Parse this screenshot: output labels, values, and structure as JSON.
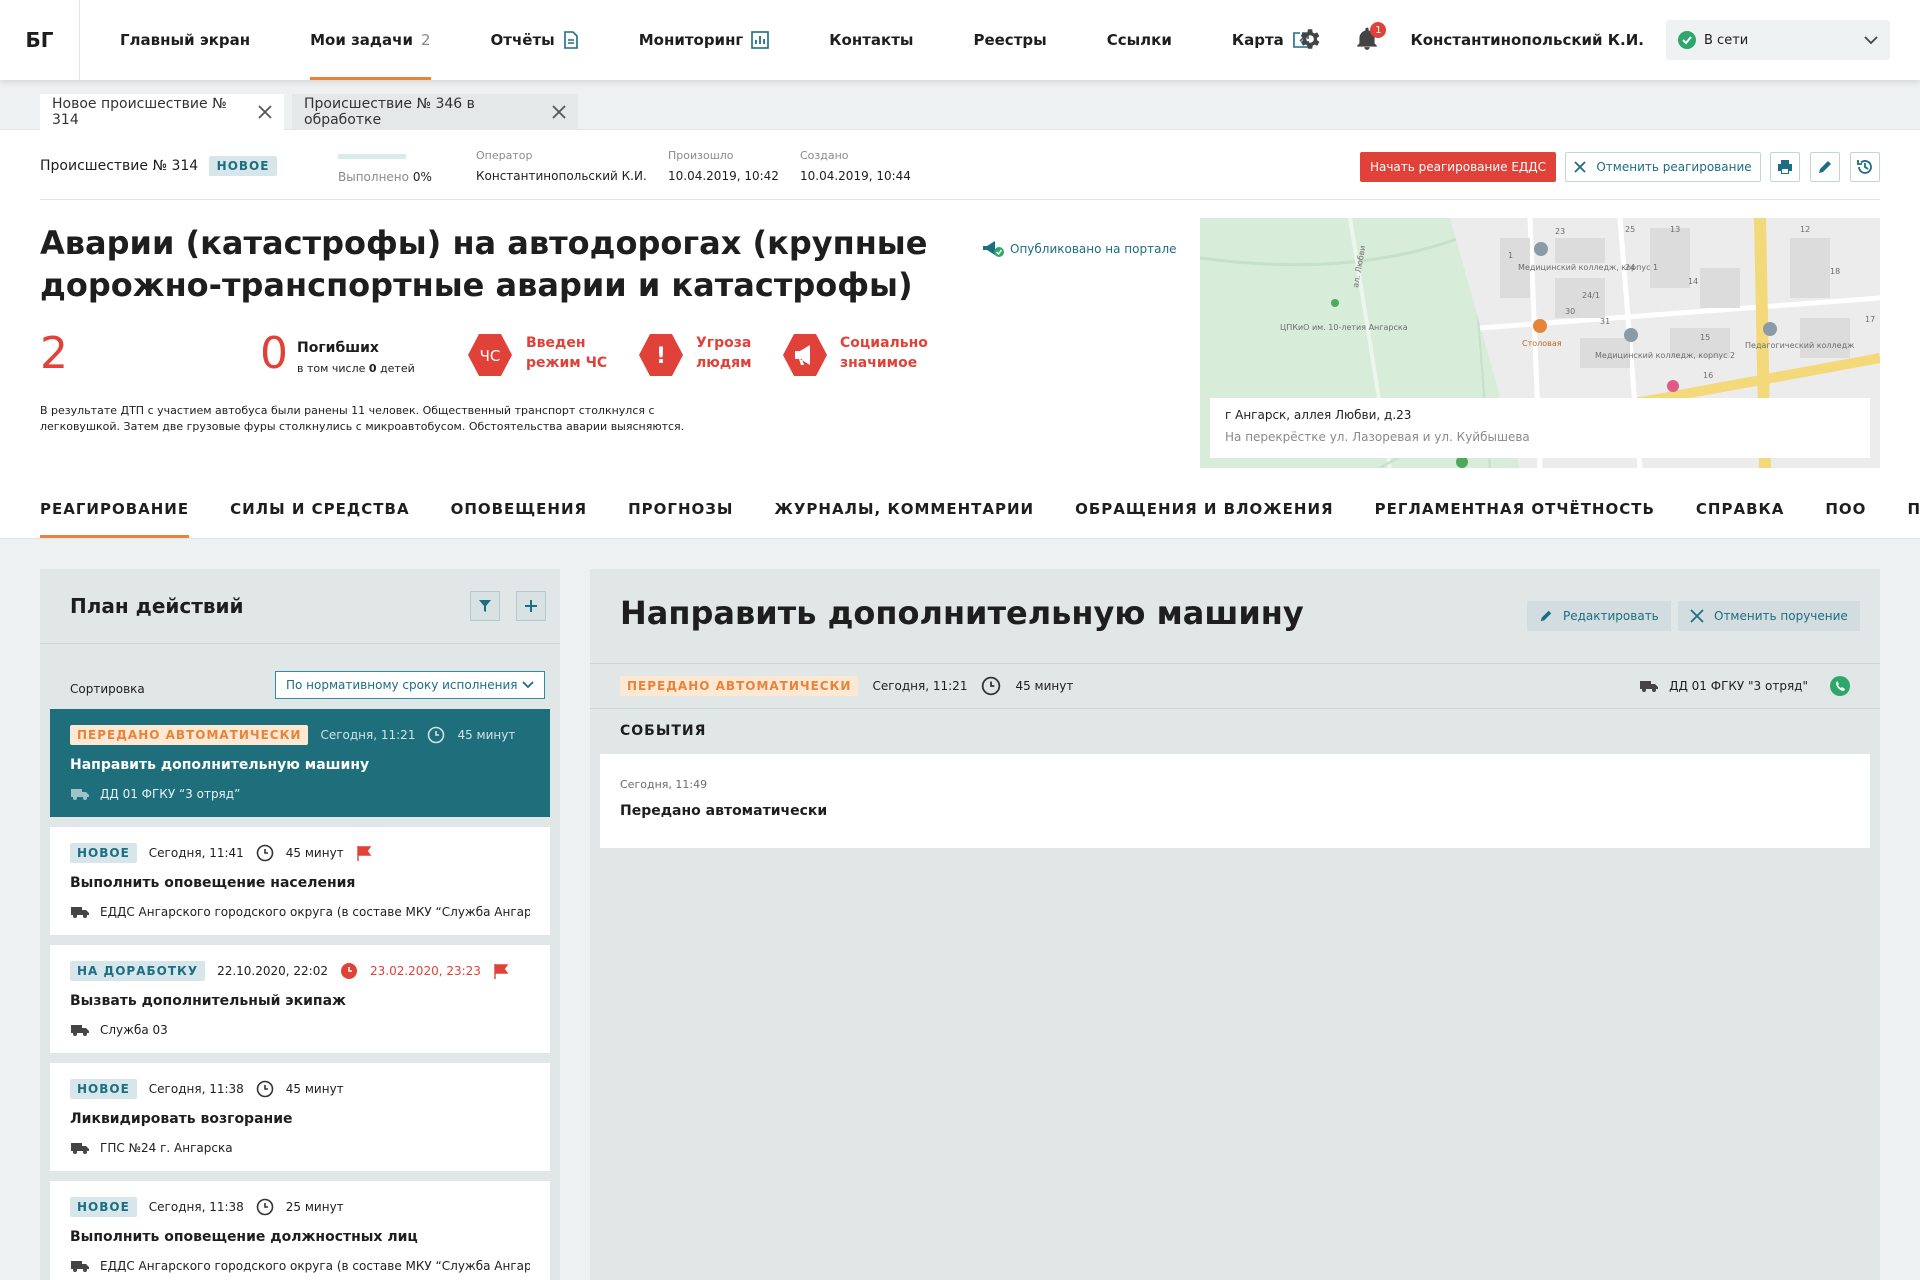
{
  "app": {
    "logo": "БГ"
  },
  "nav": [
    {
      "label": "Главный экран"
    },
    {
      "label": "Мои задачи",
      "count": "2"
    },
    {
      "label": "Отчёты"
    },
    {
      "label": "Мониторинг"
    },
    {
      "label": "Контакты"
    },
    {
      "label": "Реестры"
    },
    {
      "label": "Ссылки"
    },
    {
      "label": "Карта"
    }
  ],
  "user": {
    "name": "Константинопольский К.И.",
    "notifications": "1",
    "status": "В сети"
  },
  "doc_tabs": [
    {
      "label": "Новое происшествие № 314"
    },
    {
      "label": "Происшествие № 346 в обработке"
    }
  ],
  "incident": {
    "number": "Происшествие № 314",
    "badge": "НОВОЕ",
    "progress_label": "Выполнено",
    "progress_value": "0%",
    "progress_fraction": 0,
    "operator_label": "Оператор",
    "operator": "Константинопольский К.И.",
    "happened_label": "Произошло",
    "happened": "10.04.2019, 10:42",
    "created_label": "Создано",
    "created": "10.04.2019, 10:44",
    "start_button": "Начать реагирование ЕДДС",
    "cancel_button": "Отменить реагирование",
    "title": "Аварии (катастрофы) на автодорогах (крупные дорожно-транспортные аварии и катастрофы)",
    "published": "Опубликовано на портале",
    "injured_count": "2",
    "dead_count": "0",
    "dead_label": "Погибших",
    "dead_sub_prefix": "в том числе",
    "dead_children": "0",
    "dead_sub_suffix": "детей",
    "flags": [
      {
        "line1": "Введен",
        "line2": "режим ЧС",
        "icon_text": "ЧС"
      },
      {
        "line1": "Угроза",
        "line2": "людям",
        "icon_text": "!"
      },
      {
        "line1": "Социально",
        "line2": "значимое"
      }
    ],
    "description": "В результате ДТП с участием автобуса были ранены 11 человек. Общественный транспорт столкнулся с легковушкой. Затем две грузовые фуры столкнулись с микроавтобусом. Обстоятельства аварии выясняются.",
    "address": "г Ангарск, аллея Любви, д.23",
    "address_note": "На перекрёстке ул. Лазоревая и ул. Куйбышева"
  },
  "map": {
    "labels": [
      "Медицинский колледж, корпус 1",
      "ЦПКиО им. 10-летия Ангарска",
      "Столовая",
      "Медицинский колледж, корпус 2",
      "Педагогический колледж",
      "ал. Любви"
    ],
    "numbers": [
      "23",
      "13",
      "24",
      "14",
      "24/1",
      "18",
      "31",
      "30",
      "15",
      "17",
      "16",
      "25",
      "1",
      "12"
    ]
  },
  "sections": [
    {
      "label": "РЕАГИРОВАНИЕ"
    },
    {
      "label": "СИЛЫ И СРЕДСТВА"
    },
    {
      "label": "ОПОВЕЩЕНИЯ"
    },
    {
      "label": "ПРОГНОЗЫ"
    },
    {
      "label": "ЖУРНАЛЫ, КОММЕНТАРИИ"
    },
    {
      "label": "ОБРАЩЕНИЯ И ВЛОЖЕНИЯ"
    },
    {
      "label": "РЕГЛАМЕНТНАЯ ОТЧЁТНОСТЬ"
    },
    {
      "label": "СПРАВКА"
    },
    {
      "label": "ПОО"
    },
    {
      "label": "ПВР"
    }
  ],
  "plan": {
    "title": "План действий",
    "sort_label": "Сортировка",
    "sort_value": "По нормативному сроку исполнения",
    "items": [
      {
        "status": "ПЕРЕДАНО АВТОМАТИЧЕСКИ",
        "time": "Сегодня, 11:21",
        "deadline": "45 минут",
        "title": "Направить дополнительную машину",
        "org": "ДД 01 ФГКУ “3 отряд”"
      },
      {
        "status": "НОВОЕ",
        "time": "Сегодня, 11:41",
        "deadline": "45 минут",
        "title": "Выполнить оповещение населения",
        "org": "ЕДДС Ангарского городского округа (в составе МКУ “Служба Ангар…"
      },
      {
        "status": "НА ДОРАБОТКУ",
        "time": "22.10.2020, 22:02",
        "deadline": "23.02.2020, 23:23",
        "title": "Вызвать дополнительный экипаж",
        "org": "Служба 03"
      },
      {
        "status": "НОВОЕ",
        "time": "Сегодня, 11:38",
        "deadline": "45 минут",
        "title": "Ликвидировать возгорание",
        "org": "ГПС №24 г. Ангарска"
      },
      {
        "status": "НОВОЕ",
        "time": "Сегодня, 11:38",
        "deadline": "25 минут",
        "title": "Выполнить оповещение должностных лиц",
        "org": "ЕДДС Ангарского городского округа (в составе МКУ “Служба Ангар…"
      }
    ]
  },
  "detail": {
    "title": "Направить дополнительную машину",
    "edit_button": "Редактировать",
    "cancel_button": "Отменить поручение",
    "status": "ПЕРЕДАНО АВТОМАТИЧЕСКИ",
    "time": "Сегодня, 11:21",
    "deadline": "45 минут",
    "org": "ДД 01 ФГКУ \"3 отряд\"",
    "events_header": "СОБЫТИЯ",
    "events": [
      {
        "time": "Сегодня, 11:49",
        "text": "Передано автоматически"
      }
    ]
  },
  "colors": {
    "accent": "#e8833a",
    "danger": "#e0423a",
    "primary": "#1c6e82",
    "selected_card": "#1f6e7c"
  }
}
